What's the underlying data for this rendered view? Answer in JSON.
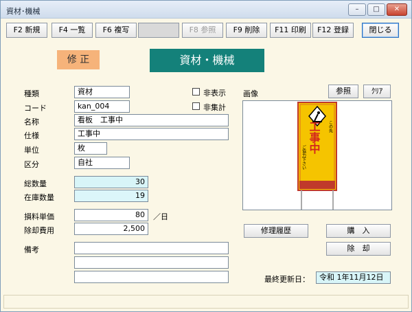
{
  "window": {
    "title": "資材･機械"
  },
  "titlebar_buttons": {
    "minimize": "–",
    "maximize": "□",
    "close": "✕"
  },
  "toolbar": {
    "f2": "F2 新規",
    "f4": "F4 一覧",
    "f6": "F6 複写",
    "blank": "",
    "f8": "F8 参照",
    "f9": "F9 削除",
    "f11": "F11 印刷",
    "f12": "F12 登録",
    "close": "閉じる"
  },
  "mode": "修 正",
  "banner": "資材・機械",
  "form": {
    "labels": {
      "category": "種類",
      "code": "コード",
      "name": "名称",
      "spec": "仕様",
      "unit": "単位",
      "division": "区分",
      "total_qty": "総数量",
      "stock_qty": "在庫数量",
      "rental_price": "損料単価",
      "disposal_cost": "除却費用",
      "remarks": "備考",
      "per_day": "／日"
    },
    "values": {
      "category": "資材",
      "code": "kan_004",
      "name": "看板　工事中",
      "spec": "工事中",
      "unit": "枚",
      "division": "自社",
      "total_qty": "30",
      "stock_qty": "19",
      "rental_price": "80",
      "disposal_cost": "2,500",
      "remarks1": "",
      "remarks2": "",
      "remarks3": ""
    },
    "checkboxes": {
      "hidden": "非表示",
      "not_aggregated": "非集計"
    }
  },
  "image": {
    "label": "画像",
    "browse": "参照",
    "clear": "ｸﾘｱ",
    "sign_main": "工事中",
    "sign_top": "この先",
    "sign_side": "ご協力下さい"
  },
  "actions": {
    "repair_history": "修理履歴",
    "purchase": "購　入",
    "dispose": "除　却"
  },
  "last_updated": {
    "label": "最終更新日：",
    "value": "令和 1年11月12日"
  }
}
